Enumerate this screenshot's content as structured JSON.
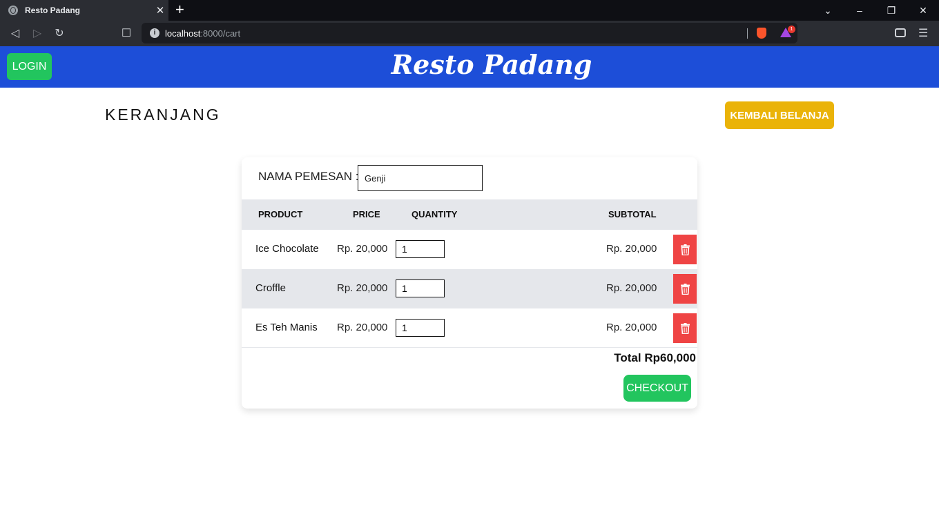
{
  "browser": {
    "tab_title": "Resto Padang",
    "tab_close": "✕",
    "new_tab": "+",
    "url_host": "localhost",
    "url_path": ":8000/cart",
    "reward_badge": "1"
  },
  "header": {
    "login_label": "LOGIN",
    "brand": "Resto Padang"
  },
  "page": {
    "title": "KERANJANG",
    "back_label": "KEMBALI BELANJA"
  },
  "cart": {
    "name_label": "NAMA PEMESAN :",
    "name_value": "Genji",
    "columns": [
      "PRODUCT",
      "PRICE",
      "QUANTITY",
      "SUBTOTAL"
    ],
    "items": [
      {
        "product": "Ice Chocolate",
        "price": "Rp. 20,000",
        "quantity": "1",
        "subtotal": "Rp. 20,000"
      },
      {
        "product": "Croffle",
        "price": "Rp. 20,000",
        "quantity": "1",
        "subtotal": "Rp. 20,000"
      },
      {
        "product": "Es Teh Manis",
        "price": "Rp. 20,000",
        "quantity": "1",
        "subtotal": "Rp. 20,000"
      }
    ],
    "total": "Total Rp60,000",
    "checkout_label": "CHECKOUT"
  },
  "icons": {
    "delete": "trash-icon",
    "login_color": "#22c55e",
    "header_color": "#1d4ed8",
    "back_color": "#eab308",
    "delete_color": "#ef4444"
  }
}
